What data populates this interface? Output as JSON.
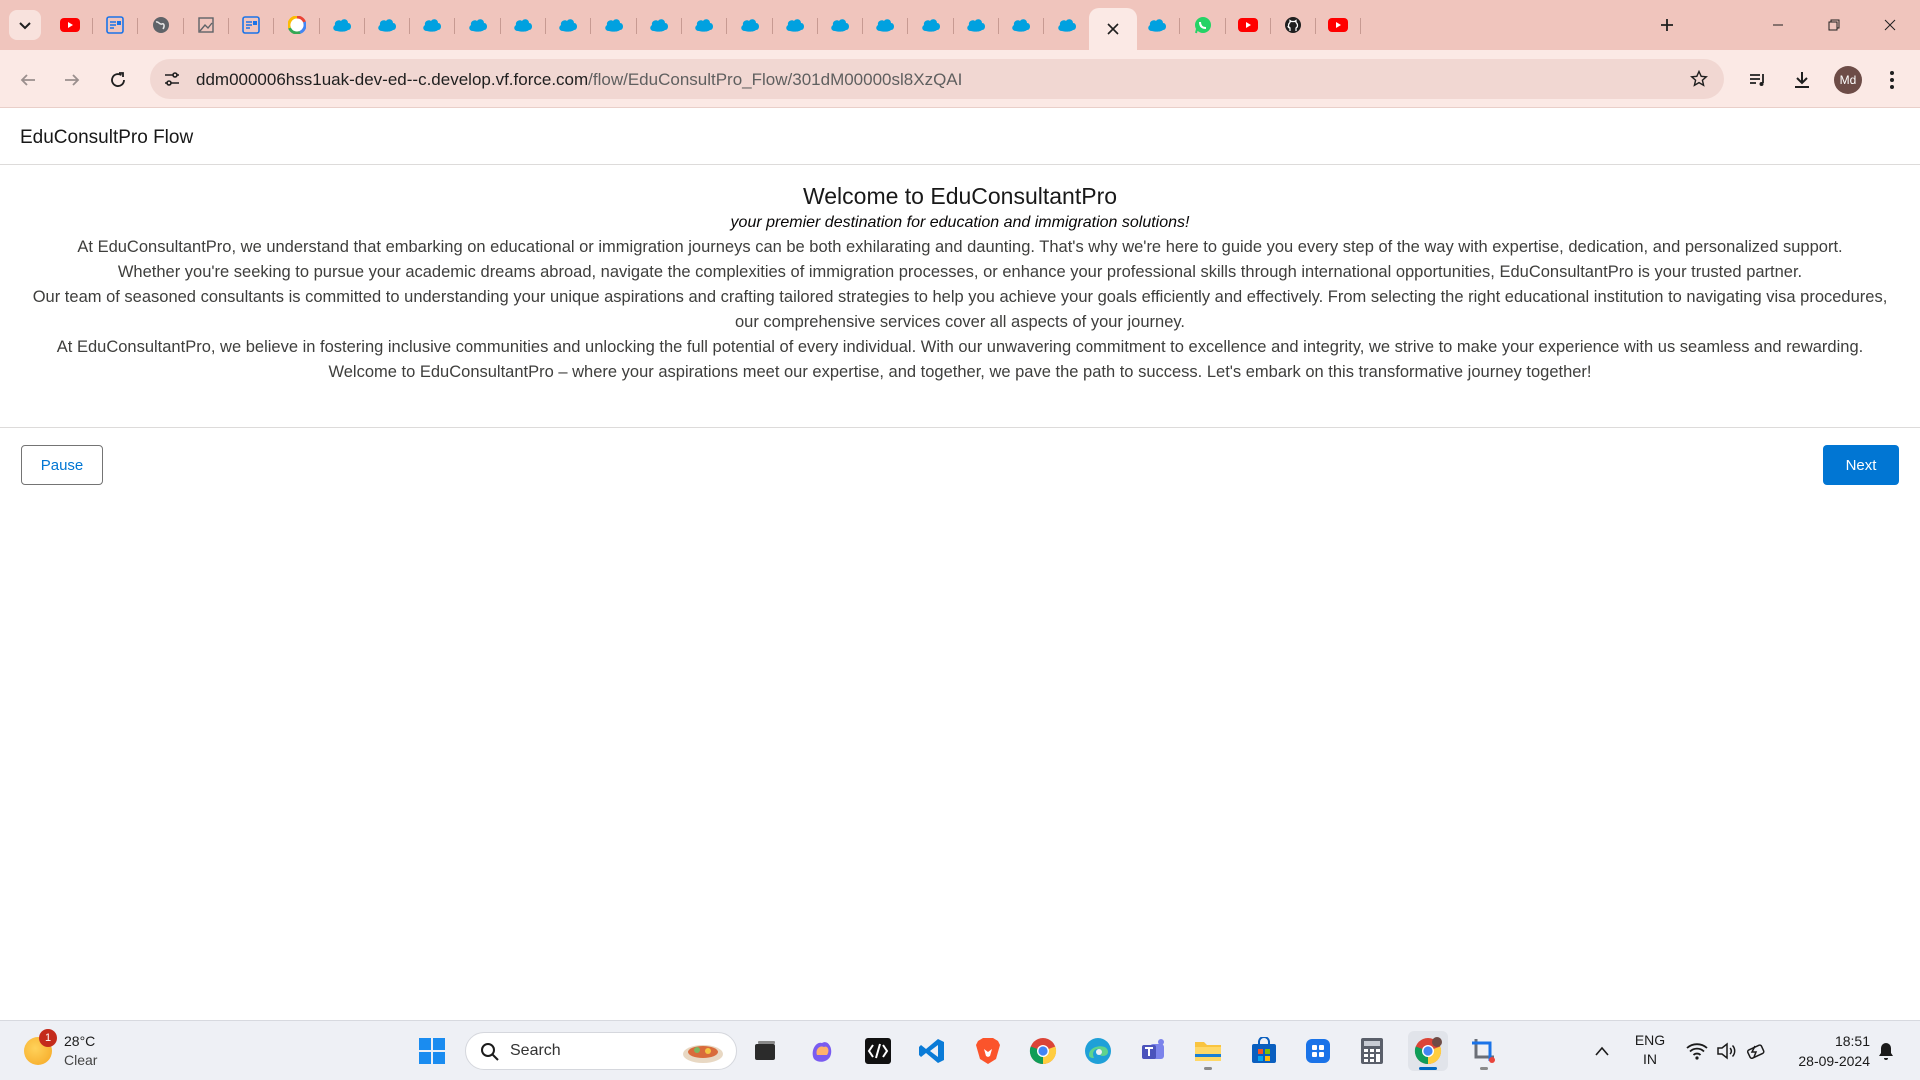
{
  "browser": {
    "tabs": [
      {
        "icon": "youtube-icon",
        "color": "#ff0000"
      },
      {
        "icon": "form-icon",
        "color": "#1a73e8"
      },
      {
        "icon": "globe-icon",
        "color": "#5f6368"
      },
      {
        "icon": "image-icon",
        "color": "#5f6368"
      },
      {
        "icon": "form-icon",
        "color": "#1a73e8"
      },
      {
        "icon": "google-icon",
        "color": "#4285f4"
      },
      {
        "icon": "salesforce-cloud-icon",
        "color": "#00a1e0"
      },
      {
        "icon": "salesforce-cloud-icon",
        "color": "#00a1e0"
      },
      {
        "icon": "salesforce-cloud-icon",
        "color": "#00a1e0"
      },
      {
        "icon": "salesforce-cloud-icon",
        "color": "#00a1e0"
      },
      {
        "icon": "salesforce-cloud-icon",
        "color": "#00a1e0"
      },
      {
        "icon": "salesforce-cloud-icon",
        "color": "#00a1e0"
      },
      {
        "icon": "salesforce-cloud-icon",
        "color": "#00a1e0"
      },
      {
        "icon": "salesforce-cloud-icon",
        "color": "#00a1e0"
      },
      {
        "icon": "salesforce-cloud-icon",
        "color": "#00a1e0"
      },
      {
        "icon": "salesforce-cloud-icon",
        "color": "#00a1e0"
      },
      {
        "icon": "salesforce-cloud-icon",
        "color": "#00a1e0"
      },
      {
        "icon": "salesforce-cloud-icon",
        "color": "#00a1e0"
      },
      {
        "icon": "salesforce-cloud-icon",
        "color": "#00a1e0"
      },
      {
        "icon": "salesforce-cloud-icon",
        "color": "#00a1e0"
      },
      {
        "icon": "salesforce-cloud-icon",
        "color": "#00a1e0"
      },
      {
        "icon": "salesforce-cloud-icon",
        "color": "#00a1e0"
      },
      {
        "icon": "salesforce-cloud-icon",
        "color": "#00a1e0"
      },
      {
        "icon": "close-icon",
        "color": "#1f1f1f",
        "active": true
      },
      {
        "icon": "salesforce-cloud-icon",
        "color": "#00a1e0"
      },
      {
        "icon": "whatsapp-icon",
        "color": "#25d366"
      },
      {
        "icon": "youtube-icon",
        "color": "#ff0000"
      },
      {
        "icon": "github-icon",
        "color": "#1f1f1f"
      },
      {
        "icon": "youtube-icon",
        "color": "#ff0000"
      }
    ],
    "url_host": "ddm000006hss1uak-dev-ed--c.develop.vf.force.com",
    "url_path": "/flow/EduConsultPro_Flow/301dM00000sl8XzQAI",
    "profile_initials": "Md"
  },
  "page": {
    "header_title": "EduConsultPro Flow",
    "heading": "Welcome to EduConsultantPro",
    "tagline": "your premier destination for education and immigration solutions!",
    "paragraphs": [
      "At EduConsultantPro, we understand that embarking on educational or immigration journeys can be both exhilarating and daunting. That's why we're here to guide you every step of the way with expertise, dedication, and personalized support.",
      "Whether you're seeking to pursue your academic dreams abroad, navigate the complexities of immigration processes, or enhance your professional skills through international opportunities, EduConsultantPro is your trusted partner.",
      "Our team of seasoned consultants is committed to understanding your unique aspirations and crafting tailored strategies to help you achieve your goals efficiently and effectively. From selecting the right educational institution to navigating visa procedures, our comprehensive services cover all aspects of your journey.",
      "At EduConsultantPro, we believe in fostering inclusive communities and unlocking the full potential of every individual. With our unwavering commitment to excellence and integrity, we strive to make your experience with us seamless and rewarding.",
      "Welcome to EduConsultantPro – where your aspirations meet our expertise, and together, we pave the path to success. Let's embark on this transformative journey together!"
    ],
    "pause_label": "Pause",
    "next_label": "Next",
    "accent_color": "#0176d3"
  },
  "taskbar": {
    "weather_badge": "1",
    "weather_temp": "28°C",
    "weather_condition": "Clear",
    "search_label": "Search",
    "lang_line1": "ENG",
    "lang_line2": "IN",
    "time": "18:51",
    "date": "28-09-2024"
  }
}
